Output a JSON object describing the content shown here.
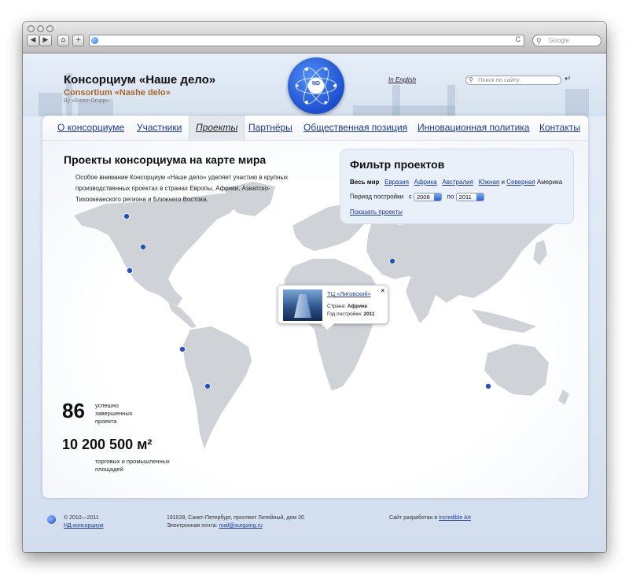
{
  "browser": {
    "nav_back": "◀",
    "nav_forward": "▶",
    "nav_home": "⌂",
    "nav_add": "+",
    "reload": "C",
    "search_placeholder": "Google",
    "icons": [
      "back-icon",
      "forward-icon",
      "home-icon",
      "add-icon",
      "reload-icon",
      "search-icon"
    ]
  },
  "header": {
    "title": "Консорциум «Наше дело»",
    "subtitle": "Consortium «Nashe delo»",
    "by": "By «Emez-Grupp»",
    "logo_text": "ND",
    "lang_link": "In English",
    "search_placeholder": "Поиск по сайту"
  },
  "nav": {
    "items": [
      {
        "label": "О консорциуме"
      },
      {
        "label": "Участники"
      },
      {
        "label": "Проекты",
        "active": true
      },
      {
        "label": "Партнёры"
      },
      {
        "label": "Общественная позиция"
      },
      {
        "label": "Инновационная политика"
      },
      {
        "label": "Контакты"
      }
    ]
  },
  "main": {
    "heading": "Проекты консорциума на карте мира",
    "intro": "Особое внимание Консорциум «Наше дело» уделяет участию в крупных производственных проектах в странах Европы, Африки, Азиатско-Тихоокеанского региона и Ближнего Востока."
  },
  "filter": {
    "title": "Фильтр проектов",
    "world": "Весь мир",
    "regions": [
      "Евразия",
      "Африка",
      "Австралия",
      "Южная"
    ],
    "and_word": "и",
    "north": "Северная",
    "america": "Америка",
    "period_label": "Период постройки",
    "from_word": "с",
    "from_year": "2008",
    "to_word": "по",
    "to_year": "2011",
    "show": "Показать проекты"
  },
  "stats": {
    "projects_count": "86",
    "projects_label": "успешно завершенных проекта",
    "area_value": "10 200 500 м²",
    "area_label": "торговых и промышленных площадей"
  },
  "popup": {
    "title": "ТЦ «Лиговский»",
    "country_label": "Страна:",
    "country": "Африка",
    "year_label": "Год постройки:",
    "year": "2011",
    "close": "×"
  },
  "footer": {
    "copyright": "© 2010—2011",
    "org_link": "НД-консорциум",
    "address": "191028, Санкт-Петербург, проспект Литейный, дом 20",
    "email_label": "Электронная почта:",
    "email": "mail@ourgoing.ru",
    "dev_text": "Сайт разработан в",
    "dev_link": "Incredible Art"
  },
  "colors": {
    "link": "#1b3a8f",
    "accent_blue": "#2450c6",
    "brand_orange": "#a7672a",
    "land": "#cfd3d8"
  }
}
